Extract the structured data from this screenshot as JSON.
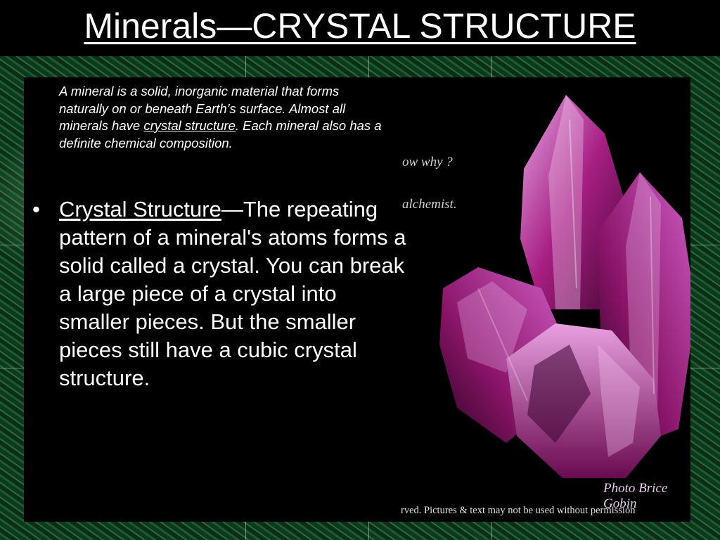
{
  "slide": {
    "title": "Minerals—CRYSTAL STRUCTURE"
  },
  "intro": {
    "before_link": "A mineral is a solid, inorganic material that forms naturally on or beneath Earth’s surface. Almost all minerals have ",
    "link_text": "crystal structure",
    "after_link": ". Each mineral also has a definite chemical composition."
  },
  "bullets": [
    {
      "term": "Crystal Structure",
      "text": "—The repeating pattern of a mineral's atoms forms a solid called a crystal.  You can break a large piece of a crystal into smaller pieces.  But the smaller pieces still have a cubic crystal structure."
    }
  ],
  "photo": {
    "overlay_line1": "ow why ?",
    "overlay_line2": "alchemist.",
    "credit": "Photo Brice Gobin",
    "rights": "rved. Pictures & text may not be used without permission"
  },
  "colors": {
    "crystal": "#b0208a",
    "crystal_light": "#e8a0e0",
    "background_green": "#174a26"
  }
}
